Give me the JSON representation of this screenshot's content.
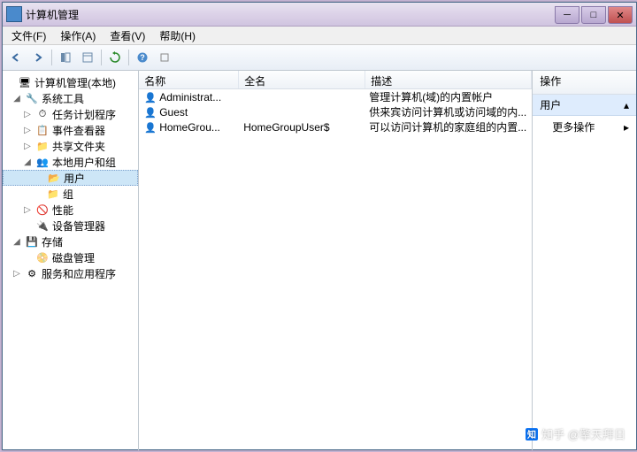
{
  "window": {
    "title": "计算机管理"
  },
  "menu": {
    "file": "文件(F)",
    "action": "操作(A)",
    "view": "查看(V)",
    "help": "帮助(H)"
  },
  "tree": {
    "root": "计算机管理(本地)",
    "sys_tools": "系统工具",
    "task_sched": "任务计划程序",
    "event_viewer": "事件查看器",
    "shared_folders": "共享文件夹",
    "local_users": "本地用户和组",
    "users": "用户",
    "groups": "组",
    "perf": "性能",
    "dev_mgr": "设备管理器",
    "storage": "存储",
    "disk_mgmt": "磁盘管理",
    "services": "服务和应用程序"
  },
  "columns": {
    "name": "名称",
    "fullname": "全名",
    "desc": "描述"
  },
  "users_list": [
    {
      "name": "Administrat...",
      "fullname": "",
      "desc": "管理计算机(域)的内置帐户"
    },
    {
      "name": "Guest",
      "fullname": "",
      "desc": "供来宾访问计算机或访问域的内..."
    },
    {
      "name": "HomeGrou...",
      "fullname": "HomeGroupUser$",
      "desc": "可以访问计算机的家庭组的内置..."
    }
  ],
  "actions": {
    "header": "操作",
    "group": "用户",
    "more": "更多操作"
  },
  "watermark": "知乎 @擎天拜日"
}
